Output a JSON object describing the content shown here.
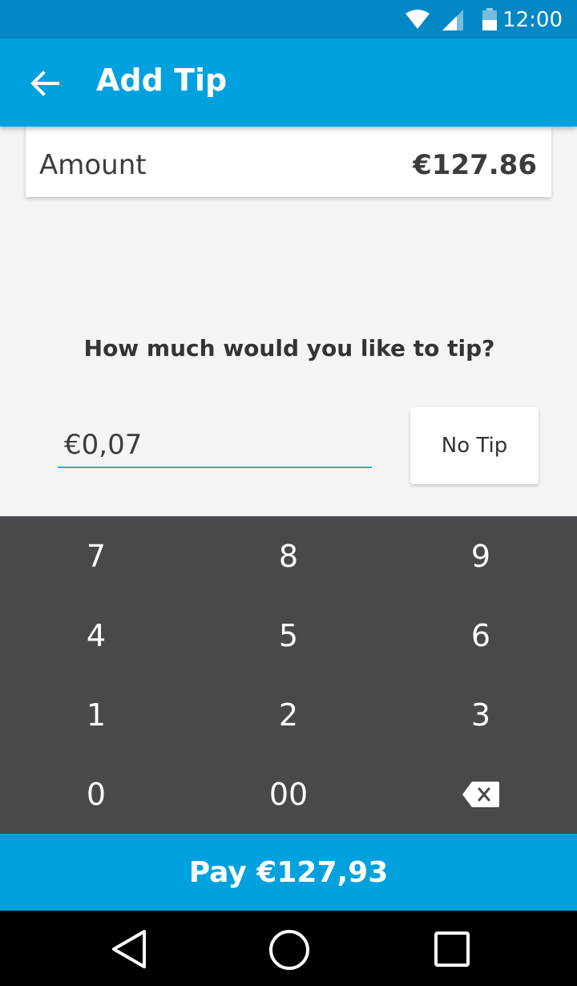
{
  "status_bar": {
    "time": "12:00",
    "icons": [
      "wifi-icon",
      "cell-signal-icon",
      "battery-icon"
    ]
  },
  "app_bar": {
    "title": "Add Tip",
    "back_icon": "arrow-back-icon"
  },
  "amount": {
    "label": "Amount",
    "value": "€127.86"
  },
  "prompt": "How much would you like to tip?",
  "tip": {
    "value": "€0,07"
  },
  "no_tip_label": "No Tip",
  "keypad": {
    "keys": [
      "7",
      "8",
      "9",
      "4",
      "5",
      "6",
      "1",
      "2",
      "3",
      "0",
      "00"
    ],
    "backspace_icon": "backspace-icon"
  },
  "pay_label": "Pay €127,93",
  "nav": {
    "icons": [
      "back-triangle-icon",
      "home-circle-icon",
      "recents-square-icon"
    ]
  },
  "colors": {
    "accent": "#00a1de",
    "status_bar": "#0288c4",
    "keypad": "#48494c",
    "underline": "#29a9e0"
  }
}
